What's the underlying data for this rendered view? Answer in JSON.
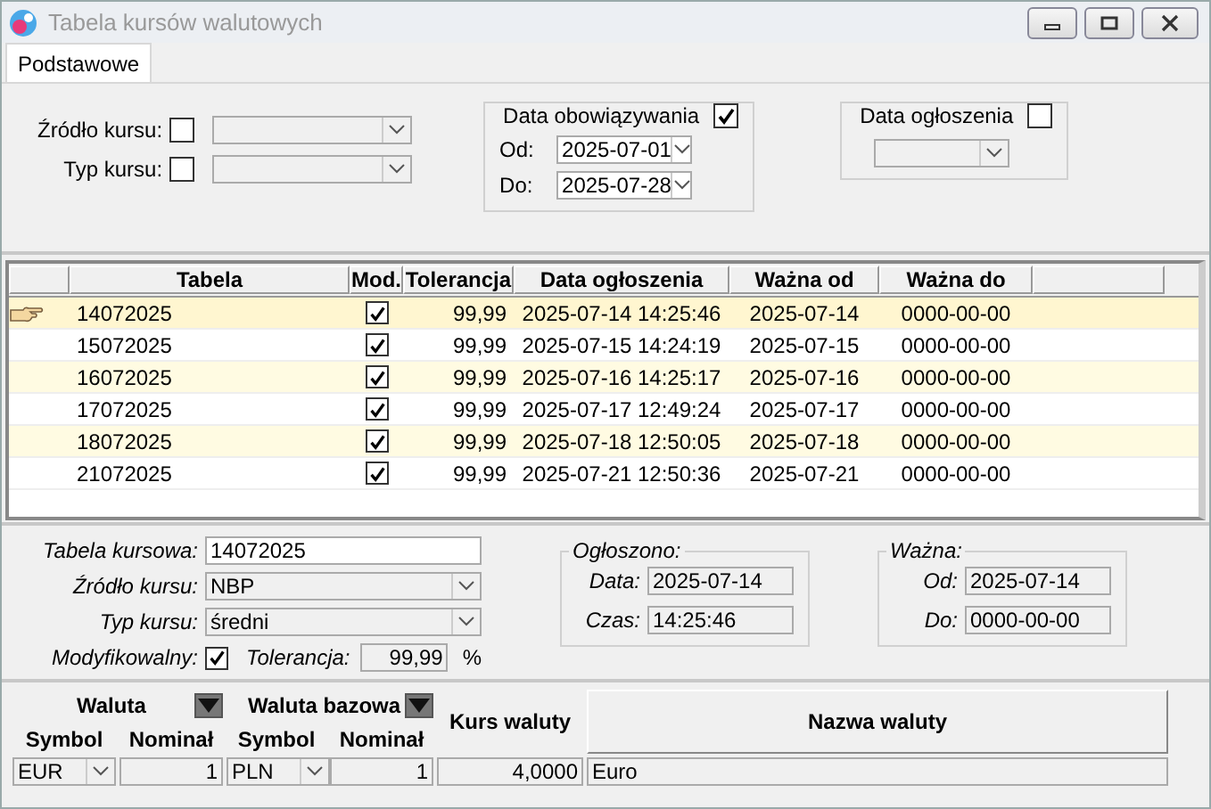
{
  "window": {
    "title": "Tabela kursów walutowych"
  },
  "tabs": [
    {
      "label": "Podstawowe",
      "selected": true
    }
  ],
  "filters": {
    "source": {
      "label": "Źródło kursu:",
      "checked": false
    },
    "type": {
      "label": "Typ kursu:",
      "checked": false
    },
    "validity": {
      "label": "Data obowiązywania",
      "checked": true,
      "from_label": "Od:",
      "from": "2025-07-01",
      "to_label": "Do:",
      "to": "2025-07-28"
    },
    "announcement": {
      "label": "Data ogłoszenia",
      "checked": false
    }
  },
  "table": {
    "columns": [
      "Tabela",
      "Mod.",
      "Tolerancja",
      "Data ogłoszenia",
      "Ważna od",
      "Ważna do"
    ],
    "rows": [
      {
        "selected": true,
        "tabela": "14072025",
        "modifiable": true,
        "tolerance": "99,99",
        "announced": "2025-07-14 14:25:46",
        "valid_from": "2025-07-14",
        "valid_to": "0000-00-00"
      },
      {
        "selected": false,
        "tabela": "15072025",
        "modifiable": true,
        "tolerance": "99,99",
        "announced": "2025-07-15 14:24:19",
        "valid_from": "2025-07-15",
        "valid_to": "0000-00-00"
      },
      {
        "selected": false,
        "tabela": "16072025",
        "modifiable": true,
        "tolerance": "99,99",
        "announced": "2025-07-16 14:25:17",
        "valid_from": "2025-07-16",
        "valid_to": "0000-00-00"
      },
      {
        "selected": false,
        "tabela": "17072025",
        "modifiable": true,
        "tolerance": "99,99",
        "announced": "2025-07-17 12:49:24",
        "valid_from": "2025-07-17",
        "valid_to": "0000-00-00"
      },
      {
        "selected": false,
        "tabela": "18072025",
        "modifiable": true,
        "tolerance": "99,99",
        "announced": "2025-07-18 12:50:05",
        "valid_from": "2025-07-18",
        "valid_to": "0000-00-00"
      },
      {
        "selected": false,
        "tabela": "21072025",
        "modifiable": true,
        "tolerance": "99,99",
        "announced": "2025-07-21 12:50:36",
        "valid_from": "2025-07-21",
        "valid_to": "0000-00-00"
      }
    ]
  },
  "details": {
    "table_label": "Tabela kursowa:",
    "table_value": "14072025",
    "source_label": "Źródło kursu:",
    "source_value": "NBP",
    "type_label": "Typ kursu:",
    "type_value": "średni",
    "modifiable_label": "Modyfikowalny:",
    "modifiable": true,
    "tolerance_label": "Tolerancja:",
    "tolerance_value": "99,99",
    "percent": "%",
    "announced": {
      "title": "Ogłoszono:",
      "date_label": "Data:",
      "date": "2025-07-14",
      "time_label": "Czas:",
      "time": "14:25:46"
    },
    "valid": {
      "title": "Ważna:",
      "from_label": "Od:",
      "from": "2025-07-14",
      "to_label": "Do:",
      "to": "0000-00-00"
    }
  },
  "currency": {
    "group_currency": "Waluta",
    "group_base": "Waluta bazowa",
    "rate_header": "Kurs waluty",
    "name_header": "Nazwa waluty",
    "columns": [
      "Symbol",
      "Nominał",
      "Symbol",
      "Nominał"
    ],
    "rows": [
      {
        "symbol": "EUR",
        "nominal": "1",
        "base_symbol": "PLN",
        "base_nominal": "1",
        "rate": "4,0000",
        "name": "Euro"
      }
    ]
  }
}
